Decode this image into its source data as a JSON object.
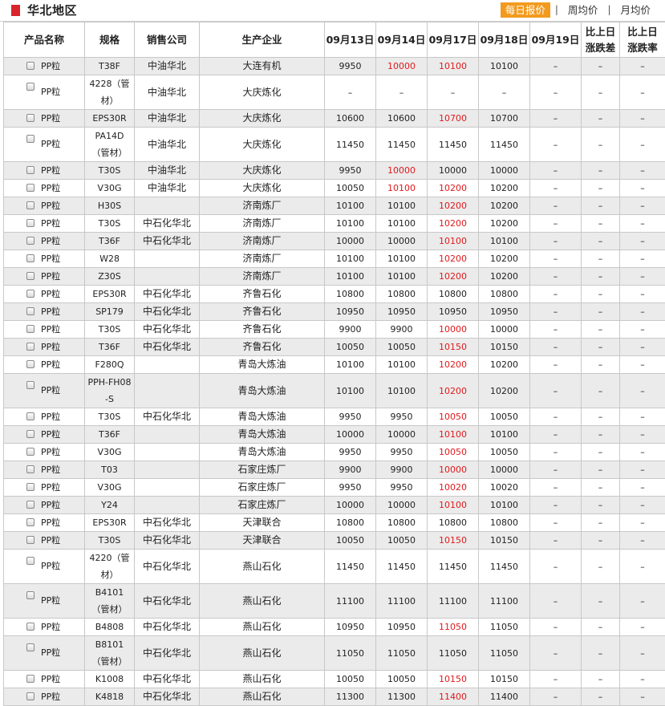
{
  "header": {
    "title": "华北地区",
    "tabs": [
      {
        "label": "每日报价",
        "active": true
      },
      {
        "label": "周均价",
        "active": false
      },
      {
        "label": "月均价",
        "active": false
      }
    ]
  },
  "table": {
    "columns": [
      "产品名称",
      "规格",
      "销售公司",
      "生产企业",
      "09月13日",
      "09月14日",
      "09月17日",
      "09月18日",
      "09月19日",
      "比上日涨跌差",
      "比上日涨跌率"
    ],
    "colors": {
      "up": "#e0191c",
      "normal": "#222222"
    },
    "rows": [
      {
        "product": "PP粒",
        "spec": "T38F",
        "seller": "中油华北",
        "maker": "大连有机",
        "p1": "9950",
        "p2": "10000",
        "p3": "10100",
        "p4": "10100",
        "p5": "–",
        "diff": "–",
        "rate": "–",
        "up2": true,
        "up3": true,
        "tall": false
      },
      {
        "product": "PP粒",
        "spec": "4228（管材）",
        "seller": "中油华北",
        "maker": "大庆炼化",
        "p1": "–",
        "p2": "–",
        "p3": "–",
        "p4": "–",
        "p5": "–",
        "diff": "–",
        "rate": "–",
        "tall": true
      },
      {
        "product": "PP粒",
        "spec": "EPS30R",
        "seller": "中油华北",
        "maker": "大庆炼化",
        "p1": "10600",
        "p2": "10600",
        "p3": "10700",
        "p4": "10700",
        "p5": "–",
        "diff": "–",
        "rate": "–",
        "up3": true,
        "tall": false
      },
      {
        "product": "PP粒",
        "spec": "PA14D（管材）",
        "seller": "中油华北",
        "maker": "大庆炼化",
        "p1": "11450",
        "p2": "11450",
        "p3": "11450",
        "p4": "11450",
        "p5": "–",
        "diff": "–",
        "rate": "–",
        "tall": true
      },
      {
        "product": "PP粒",
        "spec": "T30S",
        "seller": "中油华北",
        "maker": "大庆炼化",
        "p1": "9950",
        "p2": "10000",
        "p3": "10000",
        "p4": "10000",
        "p5": "–",
        "diff": "–",
        "rate": "–",
        "up2": true,
        "tall": false
      },
      {
        "product": "PP粒",
        "spec": "V30G",
        "seller": "中油华北",
        "maker": "大庆炼化",
        "p1": "10050",
        "p2": "10100",
        "p3": "10200",
        "p4": "10200",
        "p5": "–",
        "diff": "–",
        "rate": "–",
        "up2": true,
        "up3": true,
        "tall": false
      },
      {
        "product": "PP粒",
        "spec": "H30S",
        "seller": "",
        "maker": "济南炼厂",
        "p1": "10100",
        "p2": "10100",
        "p3": "10200",
        "p4": "10200",
        "p5": "–",
        "diff": "–",
        "rate": "–",
        "up3": true,
        "tall": false
      },
      {
        "product": "PP粒",
        "spec": "T30S",
        "seller": "中石化华北",
        "maker": "济南炼厂",
        "p1": "10100",
        "p2": "10100",
        "p3": "10200",
        "p4": "10200",
        "p5": "–",
        "diff": "–",
        "rate": "–",
        "up3": true,
        "tall": false
      },
      {
        "product": "PP粒",
        "spec": "T36F",
        "seller": "中石化华北",
        "maker": "济南炼厂",
        "p1": "10000",
        "p2": "10000",
        "p3": "10100",
        "p4": "10100",
        "p5": "–",
        "diff": "–",
        "rate": "–",
        "up3": true,
        "tall": false
      },
      {
        "product": "PP粒",
        "spec": "W28",
        "seller": "",
        "maker": "济南炼厂",
        "p1": "10100",
        "p2": "10100",
        "p3": "10200",
        "p4": "10200",
        "p5": "–",
        "diff": "–",
        "rate": "–",
        "up3": true,
        "tall": false
      },
      {
        "product": "PP粒",
        "spec": "Z30S",
        "seller": "",
        "maker": "济南炼厂",
        "p1": "10100",
        "p2": "10100",
        "p3": "10200",
        "p4": "10200",
        "p5": "–",
        "diff": "–",
        "rate": "–",
        "up3": true,
        "tall": false
      },
      {
        "product": "PP粒",
        "spec": "EPS30R",
        "seller": "中石化华北",
        "maker": "齐鲁石化",
        "p1": "10800",
        "p2": "10800",
        "p3": "10800",
        "p4": "10800",
        "p5": "–",
        "diff": "–",
        "rate": "–",
        "tall": false
      },
      {
        "product": "PP粒",
        "spec": "SP179",
        "seller": "中石化华北",
        "maker": "齐鲁石化",
        "p1": "10950",
        "p2": "10950",
        "p3": "10950",
        "p4": "10950",
        "p5": "–",
        "diff": "–",
        "rate": "–",
        "tall": false
      },
      {
        "product": "PP粒",
        "spec": "T30S",
        "seller": "中石化华北",
        "maker": "齐鲁石化",
        "p1": "9900",
        "p2": "9900",
        "p3": "10000",
        "p4": "10000",
        "p5": "–",
        "diff": "–",
        "rate": "–",
        "up3": true,
        "tall": false
      },
      {
        "product": "PP粒",
        "spec": "T36F",
        "seller": "中石化华北",
        "maker": "齐鲁石化",
        "p1": "10050",
        "p2": "10050",
        "p3": "10150",
        "p4": "10150",
        "p5": "–",
        "diff": "–",
        "rate": "–",
        "up3": true,
        "tall": false
      },
      {
        "product": "PP粒",
        "spec": "F280Q",
        "seller": "",
        "maker": "青岛大炼油",
        "p1": "10100",
        "p2": "10100",
        "p3": "10200",
        "p4": "10200",
        "p5": "–",
        "diff": "–",
        "rate": "–",
        "up3": true,
        "tall": false
      },
      {
        "product": "PP粒",
        "spec": "PPH-FH08-S",
        "seller": "",
        "maker": "青岛大炼油",
        "p1": "10100",
        "p2": "10100",
        "p3": "10200",
        "p4": "10200",
        "p5": "–",
        "diff": "–",
        "rate": "–",
        "up3": true,
        "tall": true
      },
      {
        "product": "PP粒",
        "spec": "T30S",
        "seller": "中石化华北",
        "maker": "青岛大炼油",
        "p1": "9950",
        "p2": "9950",
        "p3": "10050",
        "p4": "10050",
        "p5": "–",
        "diff": "–",
        "rate": "–",
        "up3": true,
        "tall": false
      },
      {
        "product": "PP粒",
        "spec": "T36F",
        "seller": "",
        "maker": "青岛大炼油",
        "p1": "10000",
        "p2": "10000",
        "p3": "10100",
        "p4": "10100",
        "p5": "–",
        "diff": "–",
        "rate": "–",
        "up3": true,
        "tall": false
      },
      {
        "product": "PP粒",
        "spec": "V30G",
        "seller": "",
        "maker": "青岛大炼油",
        "p1": "9950",
        "p2": "9950",
        "p3": "10050",
        "p4": "10050",
        "p5": "–",
        "diff": "–",
        "rate": "–",
        "up3": true,
        "tall": false
      },
      {
        "product": "PP粒",
        "spec": "T03",
        "seller": "",
        "maker": "石家庄炼厂",
        "p1": "9900",
        "p2": "9900",
        "p3": "10000",
        "p4": "10000",
        "p5": "–",
        "diff": "–",
        "rate": "–",
        "up3": true,
        "tall": false
      },
      {
        "product": "PP粒",
        "spec": "V30G",
        "seller": "",
        "maker": "石家庄炼厂",
        "p1": "9950",
        "p2": "9950",
        "p3": "10020",
        "p4": "10020",
        "p5": "–",
        "diff": "–",
        "rate": "–",
        "up3": true,
        "tall": false
      },
      {
        "product": "PP粒",
        "spec": "Y24",
        "seller": "",
        "maker": "石家庄炼厂",
        "p1": "10000",
        "p2": "10000",
        "p3": "10100",
        "p4": "10100",
        "p5": "–",
        "diff": "–",
        "rate": "–",
        "up3": true,
        "tall": false
      },
      {
        "product": "PP粒",
        "spec": "EPS30R",
        "seller": "中石化华北",
        "maker": "天津联合",
        "p1": "10800",
        "p2": "10800",
        "p3": "10800",
        "p4": "10800",
        "p5": "–",
        "diff": "–",
        "rate": "–",
        "tall": false
      },
      {
        "product": "PP粒",
        "spec": "T30S",
        "seller": "中石化华北",
        "maker": "天津联合",
        "p1": "10050",
        "p2": "10050",
        "p3": "10150",
        "p4": "10150",
        "p5": "–",
        "diff": "–",
        "rate": "–",
        "up3": true,
        "tall": false
      },
      {
        "product": "PP粒",
        "spec": "4220（管材）",
        "seller": "中石化华北",
        "maker": "燕山石化",
        "p1": "11450",
        "p2": "11450",
        "p3": "11450",
        "p4": "11450",
        "p5": "–",
        "diff": "–",
        "rate": "–",
        "tall": true
      },
      {
        "product": "PP粒",
        "spec": "B4101（管材）",
        "seller": "中石化华北",
        "maker": "燕山石化",
        "p1": "11100",
        "p2": "11100",
        "p3": "11100",
        "p4": "11100",
        "p5": "–",
        "diff": "–",
        "rate": "–",
        "tall": true
      },
      {
        "product": "PP粒",
        "spec": "B4808",
        "seller": "中石化华北",
        "maker": "燕山石化",
        "p1": "10950",
        "p2": "10950",
        "p3": "11050",
        "p4": "11050",
        "p5": "–",
        "diff": "–",
        "rate": "–",
        "up3": true,
        "tall": false
      },
      {
        "product": "PP粒",
        "spec": "B8101（管材）",
        "seller": "中石化华北",
        "maker": "燕山石化",
        "p1": "11050",
        "p2": "11050",
        "p3": "11050",
        "p4": "11050",
        "p5": "–",
        "diff": "–",
        "rate": "–",
        "tall": true
      },
      {
        "product": "PP粒",
        "spec": "K1008",
        "seller": "中石化华北",
        "maker": "燕山石化",
        "p1": "10050",
        "p2": "10050",
        "p3": "10150",
        "p4": "10150",
        "p5": "–",
        "diff": "–",
        "rate": "–",
        "up3": true,
        "tall": false
      },
      {
        "product": "PP粒",
        "spec": "K4818",
        "seller": "中石化华北",
        "maker": "燕山石化",
        "p1": "11300",
        "p2": "11300",
        "p3": "11400",
        "p4": "11400",
        "p5": "–",
        "diff": "–",
        "rate": "–",
        "up3": true,
        "tall": false
      }
    ]
  }
}
